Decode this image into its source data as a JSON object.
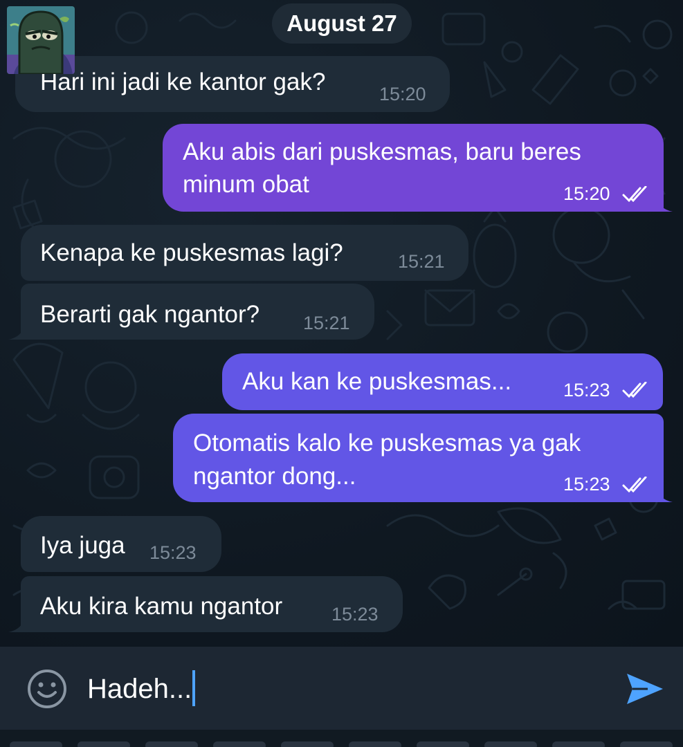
{
  "chat": {
    "date_label": "August 27",
    "messages": [
      {
        "direction": "incoming",
        "text": "Hari ini jadi ke kantor gak?",
        "time": "15:20"
      },
      {
        "direction": "outgoing",
        "lines": [
          "Aku abis dari puskesmas, baru beres",
          "minum obat"
        ],
        "time": "15:20",
        "status": "read"
      },
      {
        "direction": "incoming",
        "text": "Kenapa ke puskesmas lagi?",
        "time": "15:21"
      },
      {
        "direction": "incoming",
        "text": "Berarti gak ngantor?",
        "time": "15:21"
      },
      {
        "direction": "outgoing",
        "text": "Aku kan ke puskesmas...",
        "time": "15:23",
        "status": "read"
      },
      {
        "direction": "outgoing",
        "lines": [
          "Otomatis kalo ke puskesmas ya gak",
          "ngantor dong..."
        ],
        "time": "15:23",
        "status": "read"
      },
      {
        "direction": "incoming",
        "text": "Iya juga",
        "time": "15:23"
      },
      {
        "direction": "incoming",
        "text": "Aku kira kamu ngantor",
        "time": "15:23"
      }
    ]
  },
  "composer": {
    "value": "Hadeh...",
    "emoji_icon": "smiley-icon",
    "send_icon": "send-arrow-icon"
  },
  "icons": {
    "read_receipt": "double-check-icon",
    "avatar": "contact-avatar"
  },
  "colors": {
    "background": "#0e1621",
    "incoming_bubble": "#1f2c38",
    "outgoing_bubble_top": "#7346d6",
    "outgoing_bubble_bottom": "#6256e6",
    "accent": "#4ea3ff",
    "input_bar": "#1d2733"
  }
}
